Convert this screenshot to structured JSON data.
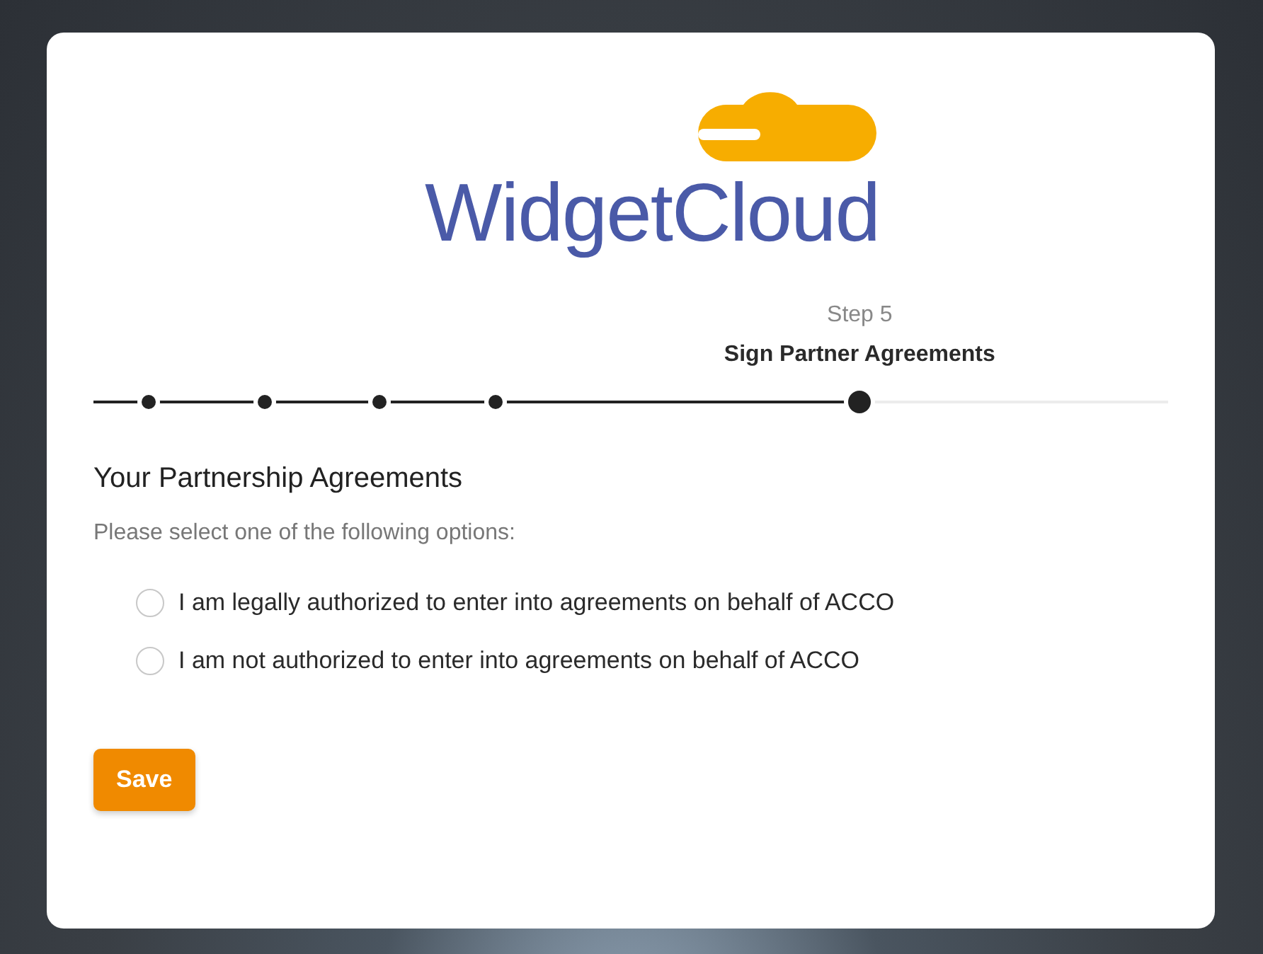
{
  "logo": {
    "text": "WidgetCloud"
  },
  "stepper": {
    "step_label": "Step 5",
    "step_title": "Sign Partner Agreements",
    "level": 0.713,
    "steps": [
      {
        "kind": "done"
      },
      {
        "kind": "done"
      },
      {
        "kind": "done"
      },
      {
        "kind": "done"
      },
      {
        "kind": "current"
      }
    ]
  },
  "section": {
    "title": "Your Partnership Agreements",
    "instruction": "Please select one of the following options:"
  },
  "options": [
    {
      "label": "I am legally authorized to enter into agreements on behalf of ACCO",
      "selected": false
    },
    {
      "label": "I am not authorized to enter into agreements on behalf of ACCO",
      "selected": false
    }
  ],
  "buttons": [
    {
      "label": "Save"
    }
  ]
}
